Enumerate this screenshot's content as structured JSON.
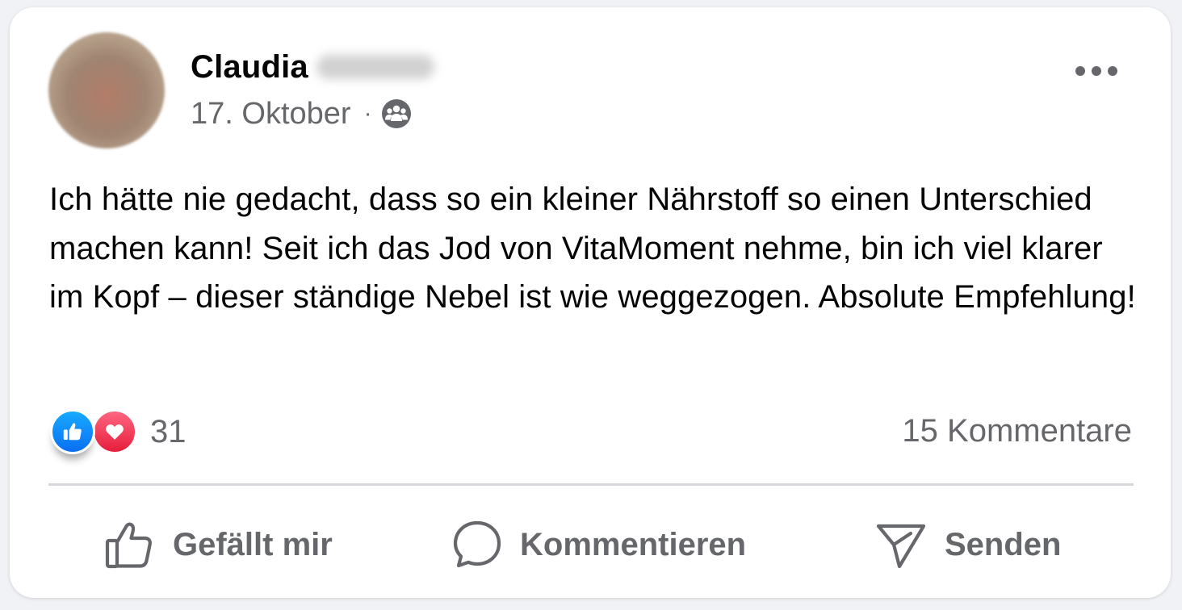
{
  "post": {
    "author": {
      "first_name": "Claudia"
    },
    "date": "17. Oktober",
    "separator": "·",
    "audience_icon": "friends-group-icon",
    "text": "Ich hätte nie gedacht, dass so ein kleiner Nährstoff so einen Unterschied machen kann! Seit ich das Jod von VitaMoment nehme, bin ich viel klarer im Kopf – dieser ständige Nebel ist wie weggezogen. Absolute Empfehlung!",
    "reactions": {
      "icons": [
        "like-reaction-icon",
        "love-reaction-icon"
      ],
      "count": "31"
    },
    "comments_count": "15 Kommentare",
    "actions": {
      "like": "Gefällt mir",
      "comment": "Kommentieren",
      "send": "Senden"
    }
  },
  "colors": {
    "text_primary": "#050505",
    "text_secondary": "#65676b",
    "like_blue": "#0a6ff2",
    "love_red": "#e61e3c"
  }
}
